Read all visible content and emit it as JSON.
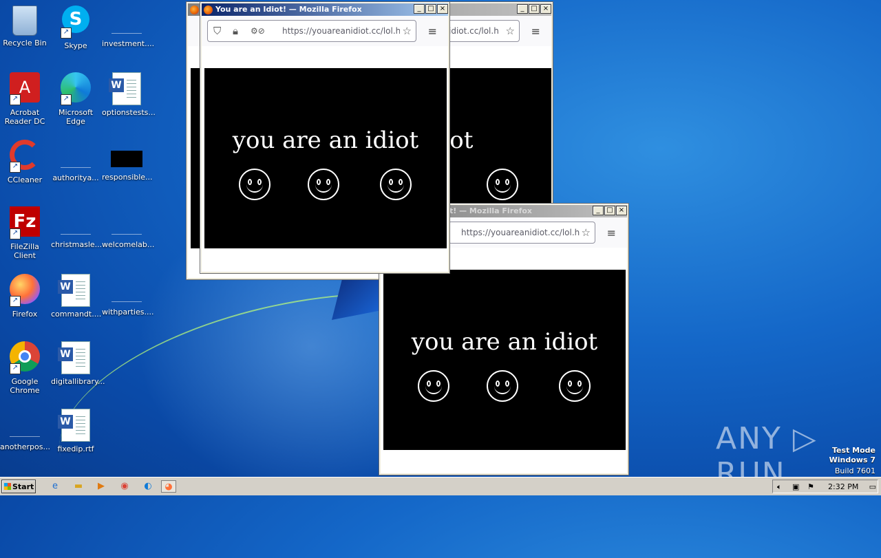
{
  "desktop": {
    "icons": [
      {
        "label": "Recycle Bin",
        "icon": "recycle-bin-icon"
      },
      {
        "label": "Skype",
        "icon": "skype-icon"
      },
      {
        "label": "investment....",
        "icon": "blank-file-icon"
      },
      {
        "label": "Acrobat Reader DC",
        "icon": "acrobat-icon"
      },
      {
        "label": "Microsoft Edge",
        "icon": "edge-icon"
      },
      {
        "label": "optionstests...",
        "icon": "word-doc-icon"
      },
      {
        "label": "CCleaner",
        "icon": "ccleaner-icon"
      },
      {
        "label": "authorityа...",
        "icon": "blank-file-icon"
      },
      {
        "label": "responsible...",
        "icon": "black-file-icon"
      },
      {
        "label": "FileZilla Client",
        "icon": "filezilla-icon"
      },
      {
        "label": "christmasle...",
        "icon": "blank-file-icon"
      },
      {
        "label": "welcomelab...",
        "icon": "blank-file-icon"
      },
      {
        "label": "Firefox",
        "icon": "firefox-icon"
      },
      {
        "label": "commandt....",
        "icon": "word-doc-icon"
      },
      {
        "label": "withparties....",
        "icon": "blank-file-icon"
      },
      {
        "label": "Google Chrome",
        "icon": "chrome-icon"
      },
      {
        "label": "digitallibrary...",
        "icon": "word-doc-icon"
      },
      {
        "label": "anotherpos...",
        "icon": "blank-file-icon"
      },
      {
        "label": "fixedip.rtf",
        "icon": "word-doc-icon"
      }
    ]
  },
  "windows": {
    "title_full": "You are an Idiot! — Mozilla Firefox",
    "title_partial": "t! — Mozilla Firefox",
    "url": "https://youareanidiot.cc/lol.h",
    "url_partial": "idiot.cc/lol.h",
    "message": "you are an idiot",
    "message_partial": "n idiot",
    "minimize": "_",
    "maximize": "□",
    "close": "×",
    "menu": "≡"
  },
  "taskbar": {
    "start_label": "Start",
    "clock": "2:32 PM",
    "pinned": [
      "ie-icon",
      "explorer-icon",
      "media-player-icon",
      "chrome-icon",
      "edge-icon",
      "firefox-icon"
    ]
  },
  "watermark": {
    "line1": "Test Mode",
    "line2": "Windows 7",
    "line3": "Build 7601",
    "anyrun": "ANY ▷ RUN"
  },
  "colors": {
    "titlebar_active": "#0a246a",
    "page_black": "#000000",
    "desktop_blue": "#1467c8"
  }
}
